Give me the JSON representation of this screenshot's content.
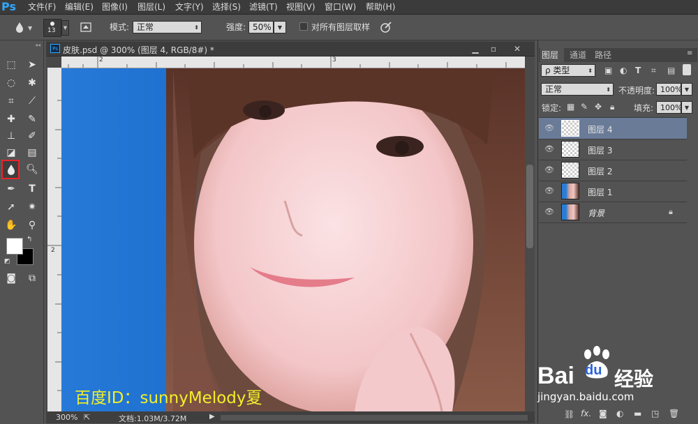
{
  "app": {
    "logo": "Ps"
  },
  "menubar": {
    "items": [
      "文件(F)",
      "编辑(E)",
      "图像(I)",
      "图层(L)",
      "文字(Y)",
      "选择(S)",
      "滤镜(T)",
      "视图(V)",
      "窗口(W)",
      "帮助(H)"
    ],
    "window_buttons": [
      "–",
      "▭",
      "✕"
    ]
  },
  "options_bar": {
    "brush_size": "13",
    "mode_label": "模式:",
    "mode_value": "正常",
    "strength_label": "强度:",
    "strength_value": "50%",
    "sample_all_label": "对所有图层取样",
    "sample_all_checked": false
  },
  "toolbox": {
    "active_tool": "blur-tool",
    "highlight_color": "#e8262b",
    "foreground_color": "#ffffff",
    "background_color": "#000000"
  },
  "document": {
    "tab_title": "皮肤.psd @ 300% (图层 4, RGB/8#) *",
    "ruler_top_labels": [
      "2",
      "3"
    ],
    "ruler_left_labels": [
      "2"
    ],
    "zoom": "300%",
    "doc_info": "文档:1.03M/3.72M"
  },
  "layers_panel": {
    "tabs": [
      "图层",
      "通道",
      "路径"
    ],
    "active_tab": "图层",
    "filter_label": "ρ 类型",
    "blend_mode": "正常",
    "opacity_label": "不透明度:",
    "opacity_value": "100%",
    "lock_label": "锁定:",
    "fill_label": "填充:",
    "fill_value": "100%",
    "layers": [
      {
        "name": "图层 4",
        "thumb": "transparent",
        "active": true
      },
      {
        "name": "图层 3",
        "thumb": "transparent",
        "active": false
      },
      {
        "name": "图层 2",
        "thumb": "transparent",
        "active": false
      },
      {
        "name": "图层 1",
        "thumb": "photo",
        "active": false
      },
      {
        "name": "背景",
        "thumb": "photo",
        "active": false,
        "locked": true
      }
    ],
    "bottom_icons": [
      "link-icon",
      "fx-icon",
      "mask-icon",
      "adjustment-icon",
      "folder-icon",
      "new-layer-icon",
      "trash-icon"
    ],
    "fx_label": "fx."
  },
  "watermark": {
    "user_id": "百度ID：sunnyMelody夏",
    "brand_text": "经验",
    "brand_url": "jingyan.baidu.com",
    "brand_logo": "Bai",
    "brand_logo_suffix": "du"
  }
}
